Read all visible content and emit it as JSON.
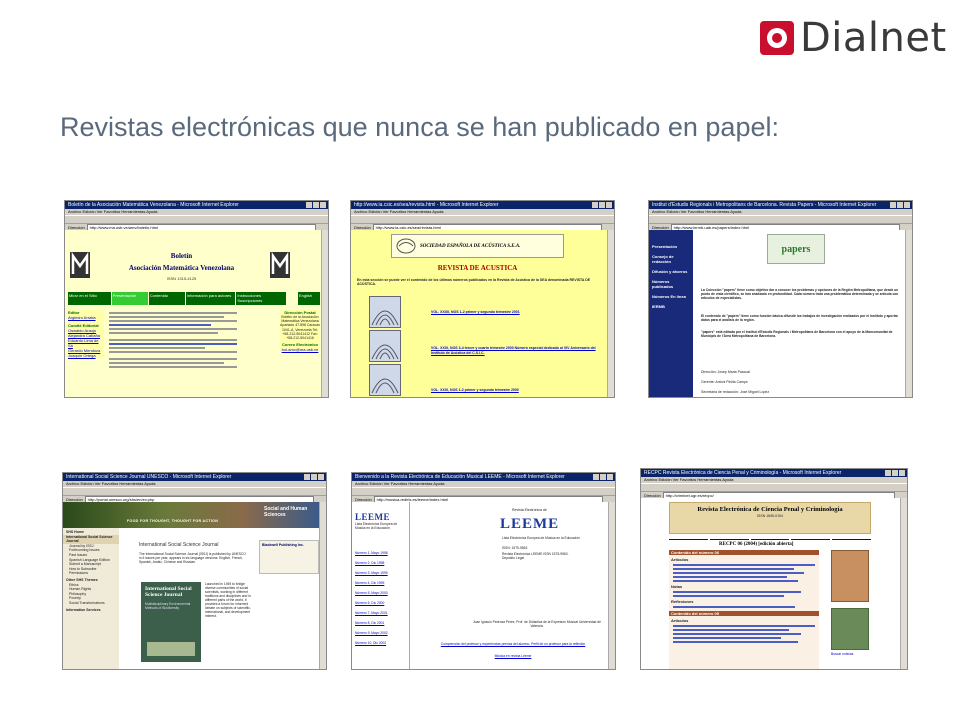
{
  "header": {
    "logo_text": "Dialnet",
    "brand_color": "#c8102e",
    "title": "Revistas electrónicas que nunca se han publicado en papel:"
  },
  "browser_menu": "Archivo  Edición  Ver  Favoritos  Herramientas  Ayuda",
  "address_label": "Dirección",
  "screenshots": [
    {
      "window_title": "Boletín de la Asociación Matemática Venezolana - Microsoft Internet Explorer",
      "url": "http://www.ma.usb.ve/amv/boletin.html",
      "heading": "Boletín",
      "subheading": "Asociación Matemática Venezolana",
      "issn": "ISSN 1315-4125",
      "nav": [
        "Mirar en el Sitio",
        "Presentación",
        "Contenido",
        "Información para autores",
        "Instrucciones Suscripciones",
        "English"
      ],
      "left_links": [
        "Editor",
        "Argimiro Arratia",
        "Comité Editorial",
        "Oswaldo Araujo",
        "Alejandra Cabaña",
        "Eduardo Lima de Sá",
        "Gerardo Mendoza",
        "Joaquín Ortega"
      ],
      "right_heading": "Dirección Postal",
      "right_text": "Boletín de la Asociación Matemática Venezolana Apartado 47.898 Caracas 1041-A, Venezuela Tel: +58-212-5041412 Fax: +58-212-5041416",
      "right_heading2": "Correo Electrónico",
      "email": "bol-amv@ma.usb.ve"
    },
    {
      "window_title": "http://www.ia.csic.es/sea/revista.html - Microsoft Internet Explorer",
      "url": "http://www.ia.csic.es/sea/revista.html",
      "society": "SOCIEDAD ESPAÑOLA DE ACÚSTICA S.E.A.",
      "heading": "REVISTA DE ACUSTICA",
      "intro": "En esta sección se puede ver el contenido de los últimos números publicados en la Revista de Acústica de la SEA denominada REVISTA DE ACÚSTICA.",
      "volumes": [
        "VOL. XXXII, NOS 1-2 primer y segundo trimestre 2001",
        "VOL. XXXI, NOS 3-4 tercer y cuarto trimestre 2000 Número especial dedicado al XIV Aniversario del Instituto de Acústica del C.S.I.C.",
        "VOL. XXXI, NOS 1-2 primer y segundo trimestre 2000"
      ]
    },
    {
      "window_title": "Institut d'Estudis Regionals i Metropolitans de Barcelona. Revista Papers - Microsoft Internet Explorer",
      "url": "http://www.iermb.uab.es/papers/index.html",
      "logo": "papers",
      "menu": [
        "Presentación",
        "Consejo de redacción",
        "Difusión y ahorros",
        "Números publicados",
        "Números En línea",
        "IERMB"
      ],
      "text": "La Colección \"papers\" tiene como objetivo dar a conocer los problemas y opciones de la Región Metropolitana, que desde un punto de vista científico, se han analizado en profundidad. Cada número trata una problemática determinada y se articula con artículos de especialistas.",
      "text2": "El contenido de \"papers\" tiene como función básica difundir los trabajos de investigación realizados por el Instituto y aportar datos para el análisis de la región.",
      "text3": "\"papers\" está editada por el Institut d'Estudis Regionals i Metropolitans de Barcelona con el apoyo de la Mancomunitat de Municipis de l'Àrea Metropolitana de Barcelona.",
      "footer": [
        "Dirección: Josep Maria Pascual",
        "Gerente: Antoni Pinilla Camps",
        "Secretaria de redacción: José Miguel López"
      ]
    },
    {
      "window_title": "International Social Science Journal UNESCO - Microsoft Internet Explorer",
      "url": "http://portal.unesco.org/shs/en/ev.php",
      "banner_left": "FOOD FOR THOUGHT, THOUGHT FOR ACTION",
      "banner_right": "Social and Human Sciences",
      "side_menu": [
        "SHS Home",
        "International Social Science Journal",
        "Journal by ISSJ",
        "Forthcoming Issues",
        "Past Issues",
        "Spanish Language Edition",
        "Submit a Manuscript",
        "How to Subscribe",
        "Permissions",
        "Other SHS Themes",
        "Ethics",
        "Human Rights",
        "Philosophy",
        "Poverty",
        "Social Transformations",
        "Information Services"
      ],
      "heading": "International Social Science Journal",
      "intro": "The International Social Science Journal (ISSJ) is published by UNESCO in 6 issues per year, appears in six language versions: English, French, Spanish, Arabic, Chinese and Russian.",
      "cover_title": "International Social Science Journal",
      "cover_sub": "Multidisciplinary Environmental Methods of Biodiversity",
      "right_box": "Blackwell Publishing Inc.",
      "body": "Launched in 1949 to bridge diverse communities of social scientists, working in different traditions and disciplines and in different parts of the world, it provides a forum for informed debate on subjects of scientific, international, and development interest."
    },
    {
      "window_title": "Bienvenido a la Revista Electrónica de Educación Musical LEEME - Microsoft Internet Explorer",
      "url": "http://musica.rediris.es/leeme/index.html",
      "logo": "LEEME",
      "left_caption": "Lista Electrónica Europea de Música en la Educación",
      "issues": [
        "Número 1, Mayo 1998",
        "Número 2, Dic 1998",
        "Número 3, Mayo 1999",
        "Número 4, Dic 1999",
        "Número 5, Mayo 2000",
        "Número 6, Dic 2000",
        "Número 7, Mayo 2001",
        "Número 8, Dic 2001",
        "Número 9, Mayo 2002",
        "Número 10, Dic 2002"
      ],
      "center_top": "Revista Electrónica de",
      "center_caption": "Lista Electrónica Europea de Música en la Educación",
      "issn": "ISSN: 1575-9563",
      "center_info": "Revista Electrónica LEEME ISSN 1575-9563. Depósito Legal.",
      "credits": "Juan Ignacio Pedrosa Pérez. Prof. de Didáctica de la Expresión Musical Universidad de Valencia.",
      "bottom_link": "Comprensión del profesor y experiencias previas del alumno. Perfil de un profesor para la reflexión",
      "bottom_link2": "Música en revista Leeme"
    },
    {
      "window_title": "RECPC Revista Electrónica de Ciencia Penal y Criminología - Microsoft Internet Explorer",
      "url": "http://criminet.ugr.es/recpc/",
      "heading": "Revista Electrónica de Ciencia Penal y Criminología",
      "issn": "ISSN 1695-0194",
      "issue_line": "RECPC 06 (2004) [edición abierta]",
      "section1": "Contenido del número 06",
      "section2": "Contenido del número 05",
      "section_labels": [
        "Artículos",
        "Notas",
        "Reflexiones",
        "Artículos"
      ],
      "right_label": "Buscar noticias"
    }
  ]
}
